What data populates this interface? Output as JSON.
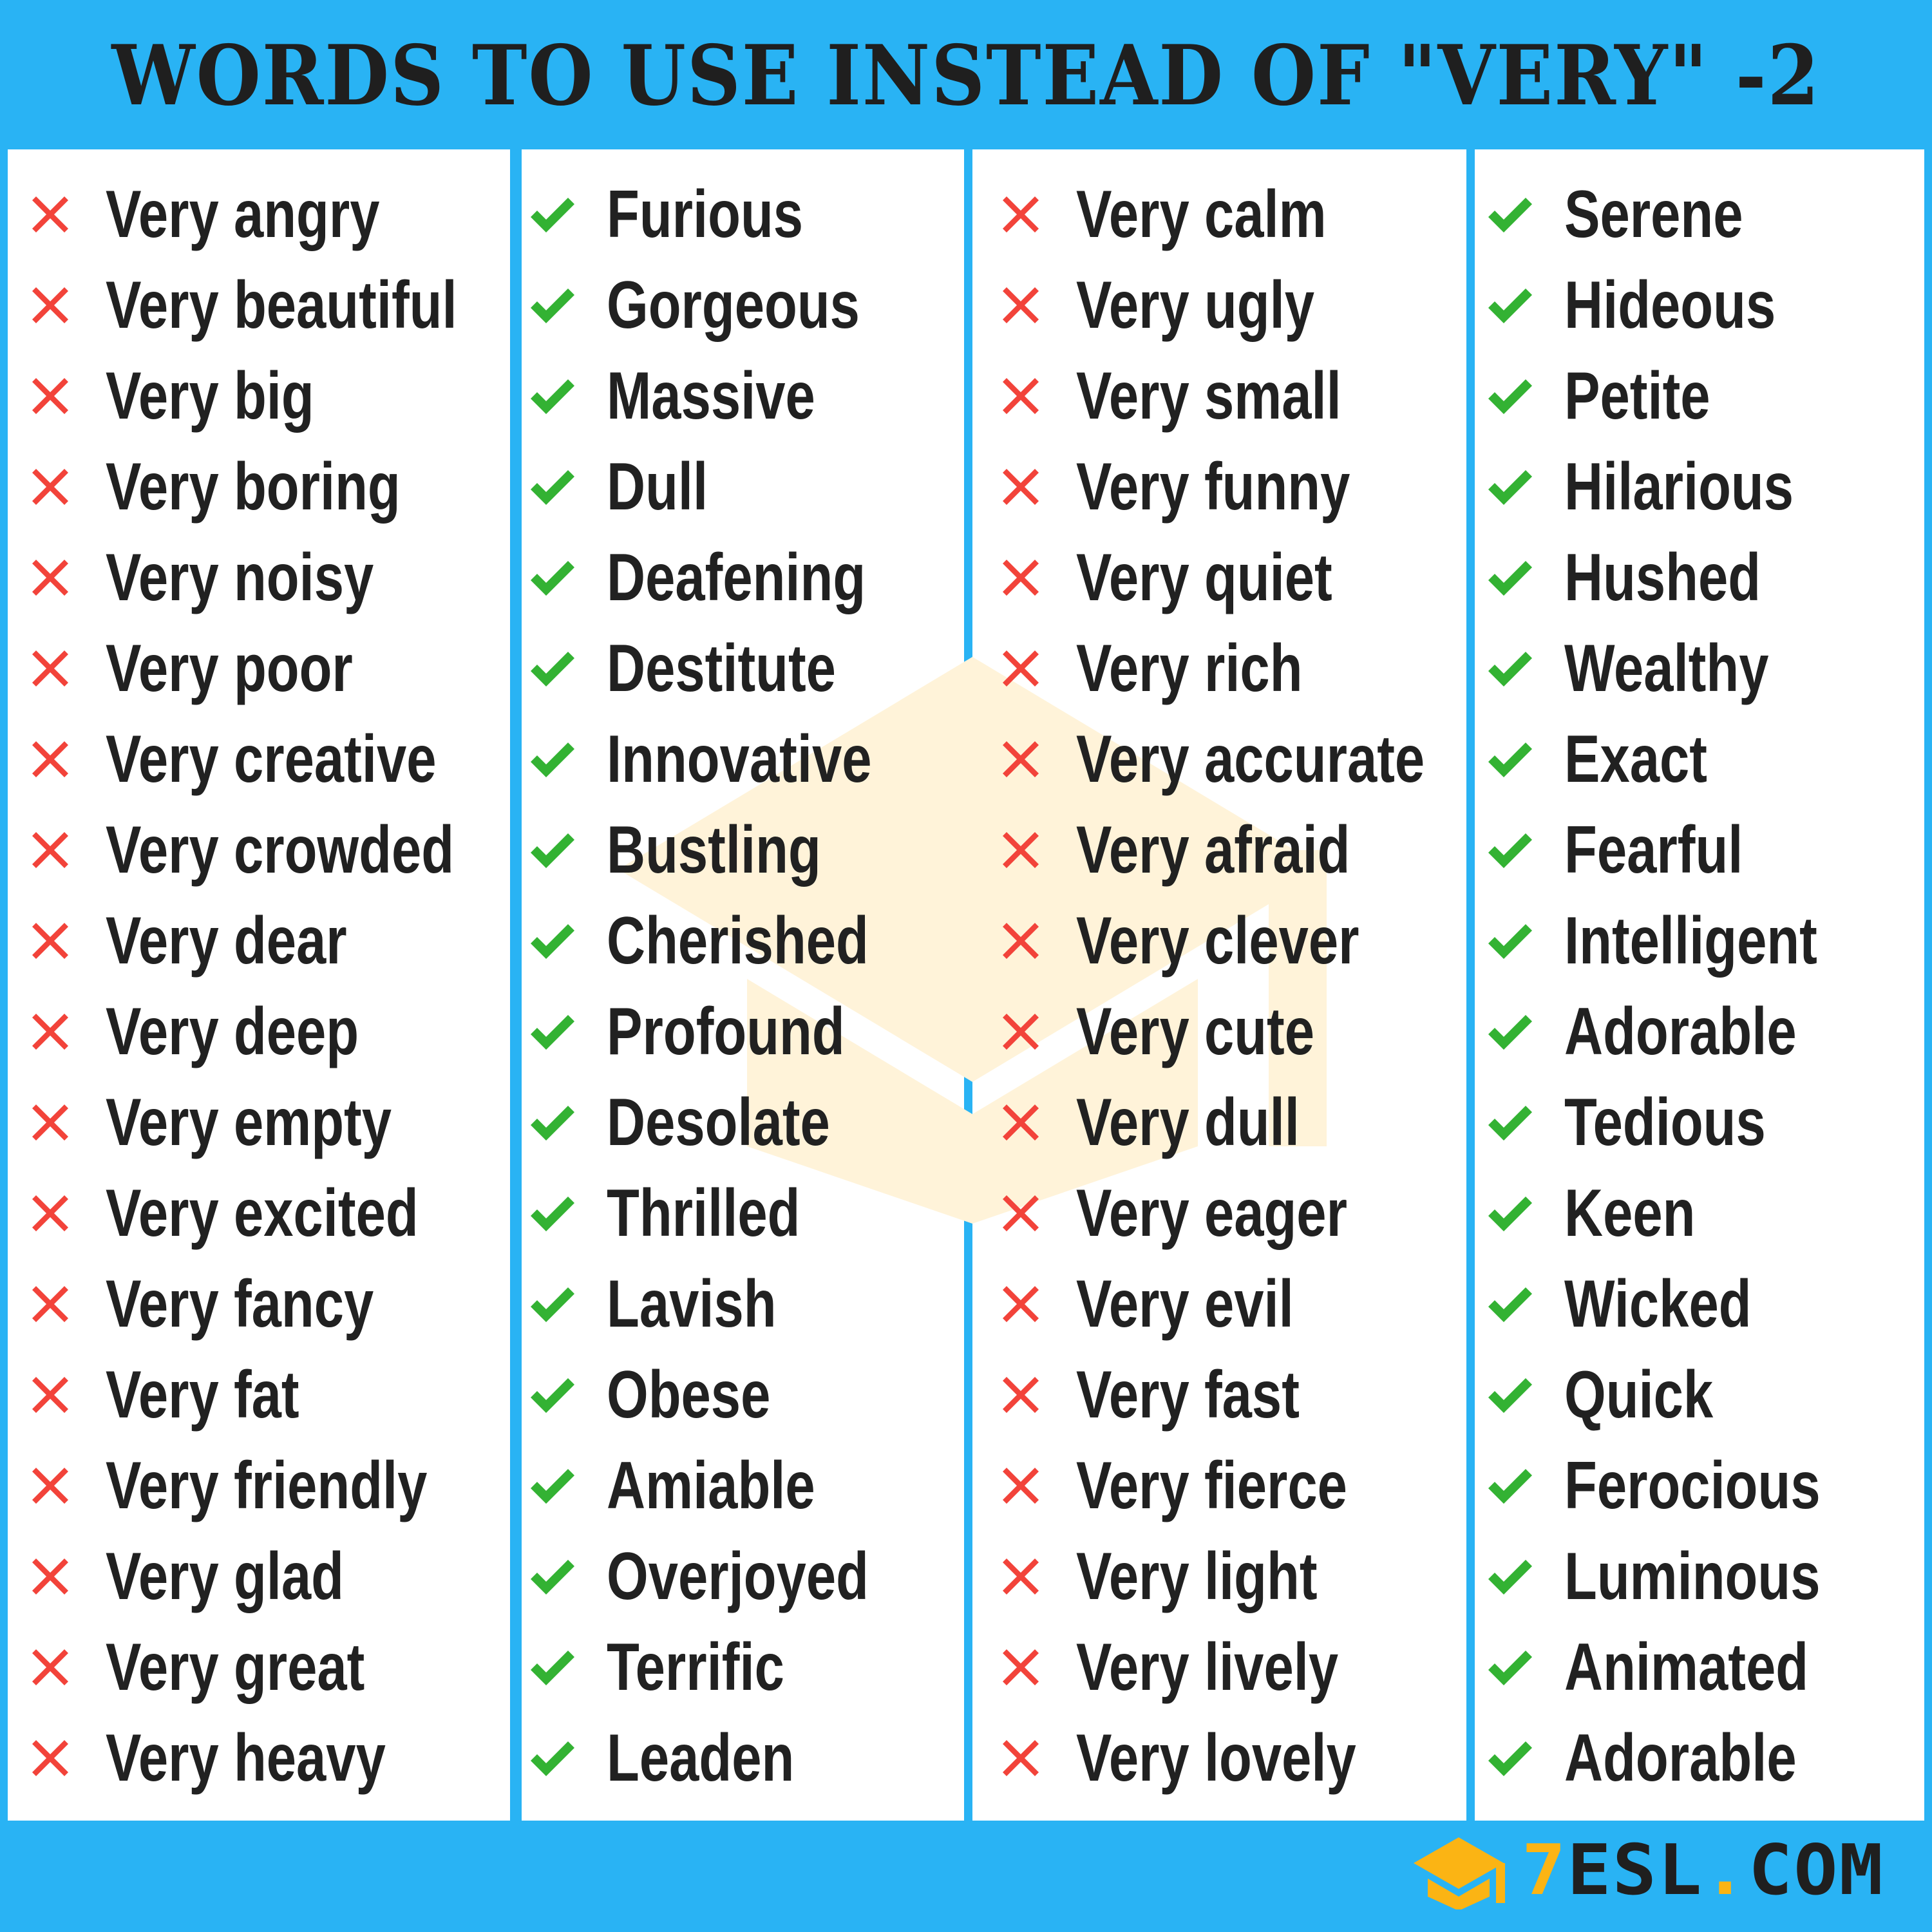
{
  "title": "WORDS TO USE INSTEAD OF \"VERY\" -2",
  "colors": {
    "background": "#29b3f4",
    "panel": "#ffffff",
    "text": "#212121",
    "wrong_icon": "#f2433a",
    "right_icon": "#33b233",
    "logo_accent": "#fbb414",
    "watermark": "#fff3d9"
  },
  "icons": {
    "wrong": "cross-icon",
    "right": "check-icon"
  },
  "columns": [
    {
      "type": "wrong",
      "items": [
        "Very angry",
        "Very beautiful",
        "Very big",
        "Very boring",
        "Very noisy",
        "Very poor",
        "Very creative",
        "Very crowded",
        "Very dear",
        "Very deep",
        "Very empty",
        "Very excited",
        "Very fancy",
        "Very fat",
        "Very friendly",
        "Very glad",
        "Very great",
        "Very heavy"
      ]
    },
    {
      "type": "right",
      "items": [
        "Furious",
        "Gorgeous",
        "Massive",
        "Dull",
        "Deafening",
        "Destitute",
        "Innovative",
        "Bustling",
        "Cherished",
        "Profound",
        "Desolate",
        "Thrilled",
        "Lavish",
        "Obese",
        "Amiable",
        "Overjoyed",
        "Terrific",
        "Leaden"
      ]
    },
    {
      "type": "wrong",
      "items": [
        "Very calm",
        "Very ugly",
        "Very small",
        "Very funny",
        "Very quiet",
        "Very rich",
        "Very accurate",
        "Very afraid",
        "Very clever",
        "Very cute",
        "Very dull",
        "Very eager",
        "Very evil",
        "Very fast",
        "Very fierce",
        "Very light",
        "Very lively",
        "Very lovely"
      ]
    },
    {
      "type": "right",
      "items": [
        "Serene",
        "Hideous",
        "Petite",
        "Hilarious",
        "Hushed",
        "Wealthy",
        "Exact",
        "Fearful",
        "Intelligent",
        "Adorable",
        "Tedious",
        "Keen",
        "Wicked",
        "Quick",
        "Ferocious",
        "Luminous",
        "Animated",
        "Adorable"
      ]
    }
  ],
  "logo": {
    "prefix": "7",
    "name": "ESL",
    "dot": ".",
    "tld": "COM"
  }
}
